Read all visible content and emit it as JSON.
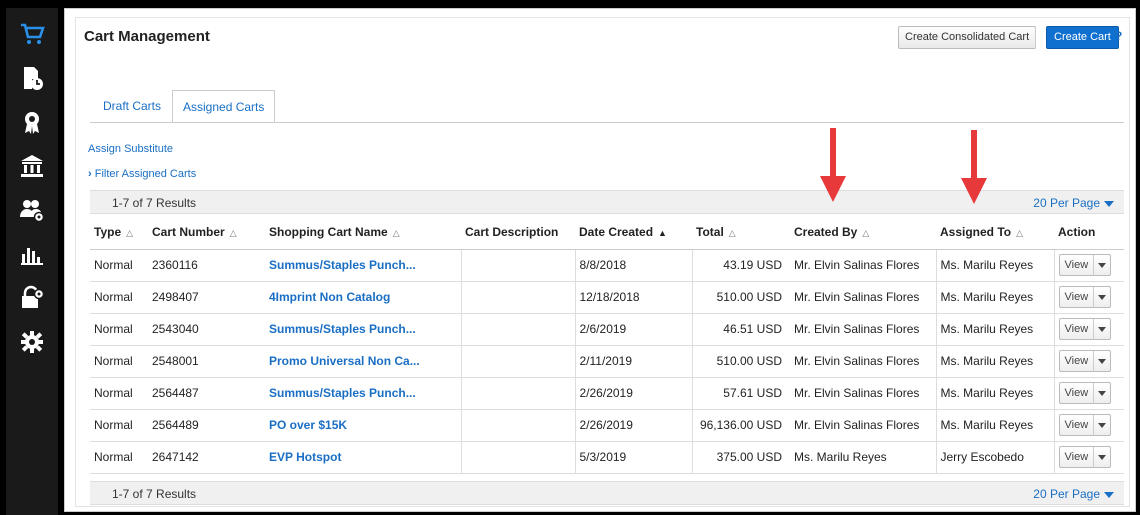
{
  "header": {
    "title": "Cart Management",
    "consolidated_label": "Create Consolidated Cart",
    "create_label": "Create Cart",
    "help_label": "?"
  },
  "tabs": [
    {
      "label": "Draft Carts",
      "active": false
    },
    {
      "label": "Assigned Carts",
      "active": true
    }
  ],
  "links": {
    "assign_substitute": "Assign Substitute",
    "filter": "Filter Assigned Carts"
  },
  "results": {
    "count_text": "1-7 of 7 Results",
    "per_page": "20 Per Page"
  },
  "table": {
    "headers": {
      "type": "Type",
      "cart_number": "Cart Number",
      "name": "Shopping Cart Name",
      "description": "Cart Description",
      "date": "Date Created",
      "total": "Total",
      "created_by": "Created By",
      "assigned_to": "Assigned To",
      "action": "Action"
    },
    "rows": [
      {
        "type": "Normal",
        "cart_number": "2360116",
        "name": "Summus/Staples Punch...",
        "description": "",
        "date": "8/8/2018",
        "total": "43.19 USD",
        "created_by": "Mr. Elvin Salinas Flores",
        "assigned_to": "Ms. Marilu Reyes",
        "action": "View"
      },
      {
        "type": "Normal",
        "cart_number": "2498407",
        "name": "4Imprint Non Catalog",
        "description": "",
        "date": "12/18/2018",
        "total": "510.00 USD",
        "created_by": "Mr. Elvin Salinas Flores",
        "assigned_to": "Ms. Marilu Reyes",
        "action": "View"
      },
      {
        "type": "Normal",
        "cart_number": "2543040",
        "name": "Summus/Staples Punch...",
        "description": "",
        "date": "2/6/2019",
        "total": "46.51 USD",
        "created_by": "Mr. Elvin Salinas Flores",
        "assigned_to": "Ms. Marilu Reyes",
        "action": "View"
      },
      {
        "type": "Normal",
        "cart_number": "2548001",
        "name": "Promo Universal Non Ca...",
        "description": "",
        "date": "2/11/2019",
        "total": "510.00 USD",
        "created_by": "Mr. Elvin Salinas Flores",
        "assigned_to": "Ms. Marilu Reyes",
        "action": "View"
      },
      {
        "type": "Normal",
        "cart_number": "2564487",
        "name": "Summus/Staples Punch...",
        "description": "",
        "date": "2/26/2019",
        "total": "57.61 USD",
        "created_by": "Mr. Elvin Salinas Flores",
        "assigned_to": "Ms. Marilu Reyes",
        "action": "View"
      },
      {
        "type": "Normal",
        "cart_number": "2564489",
        "name": "PO over $15K",
        "description": "",
        "date": "2/26/2019",
        "total": "96,136.00 USD",
        "created_by": "Mr. Elvin Salinas Flores",
        "assigned_to": "Ms. Marilu Reyes",
        "action": "View"
      },
      {
        "type": "Normal",
        "cart_number": "2647142",
        "name": "EVP Hotspot",
        "description": "",
        "date": "5/3/2019",
        "total": "375.00 USD",
        "created_by": "Ms. Marilu Reyes",
        "assigned_to": "Jerry Escobedo",
        "action": "View"
      }
    ]
  },
  "sidebar": {
    "items": [
      {
        "icon": "cart-icon"
      },
      {
        "icon": "document-clock-icon"
      },
      {
        "icon": "award-icon"
      },
      {
        "icon": "bank-icon"
      },
      {
        "icon": "users-gear-icon"
      },
      {
        "icon": "bar-chart-icon"
      },
      {
        "icon": "lock-gear-icon"
      },
      {
        "icon": "gear-icon"
      }
    ]
  },
  "colors": {
    "accent": "#1a6fc4",
    "annotation_arrow": "#e8393a",
    "sidebar_bg": "#1a1a1a"
  }
}
